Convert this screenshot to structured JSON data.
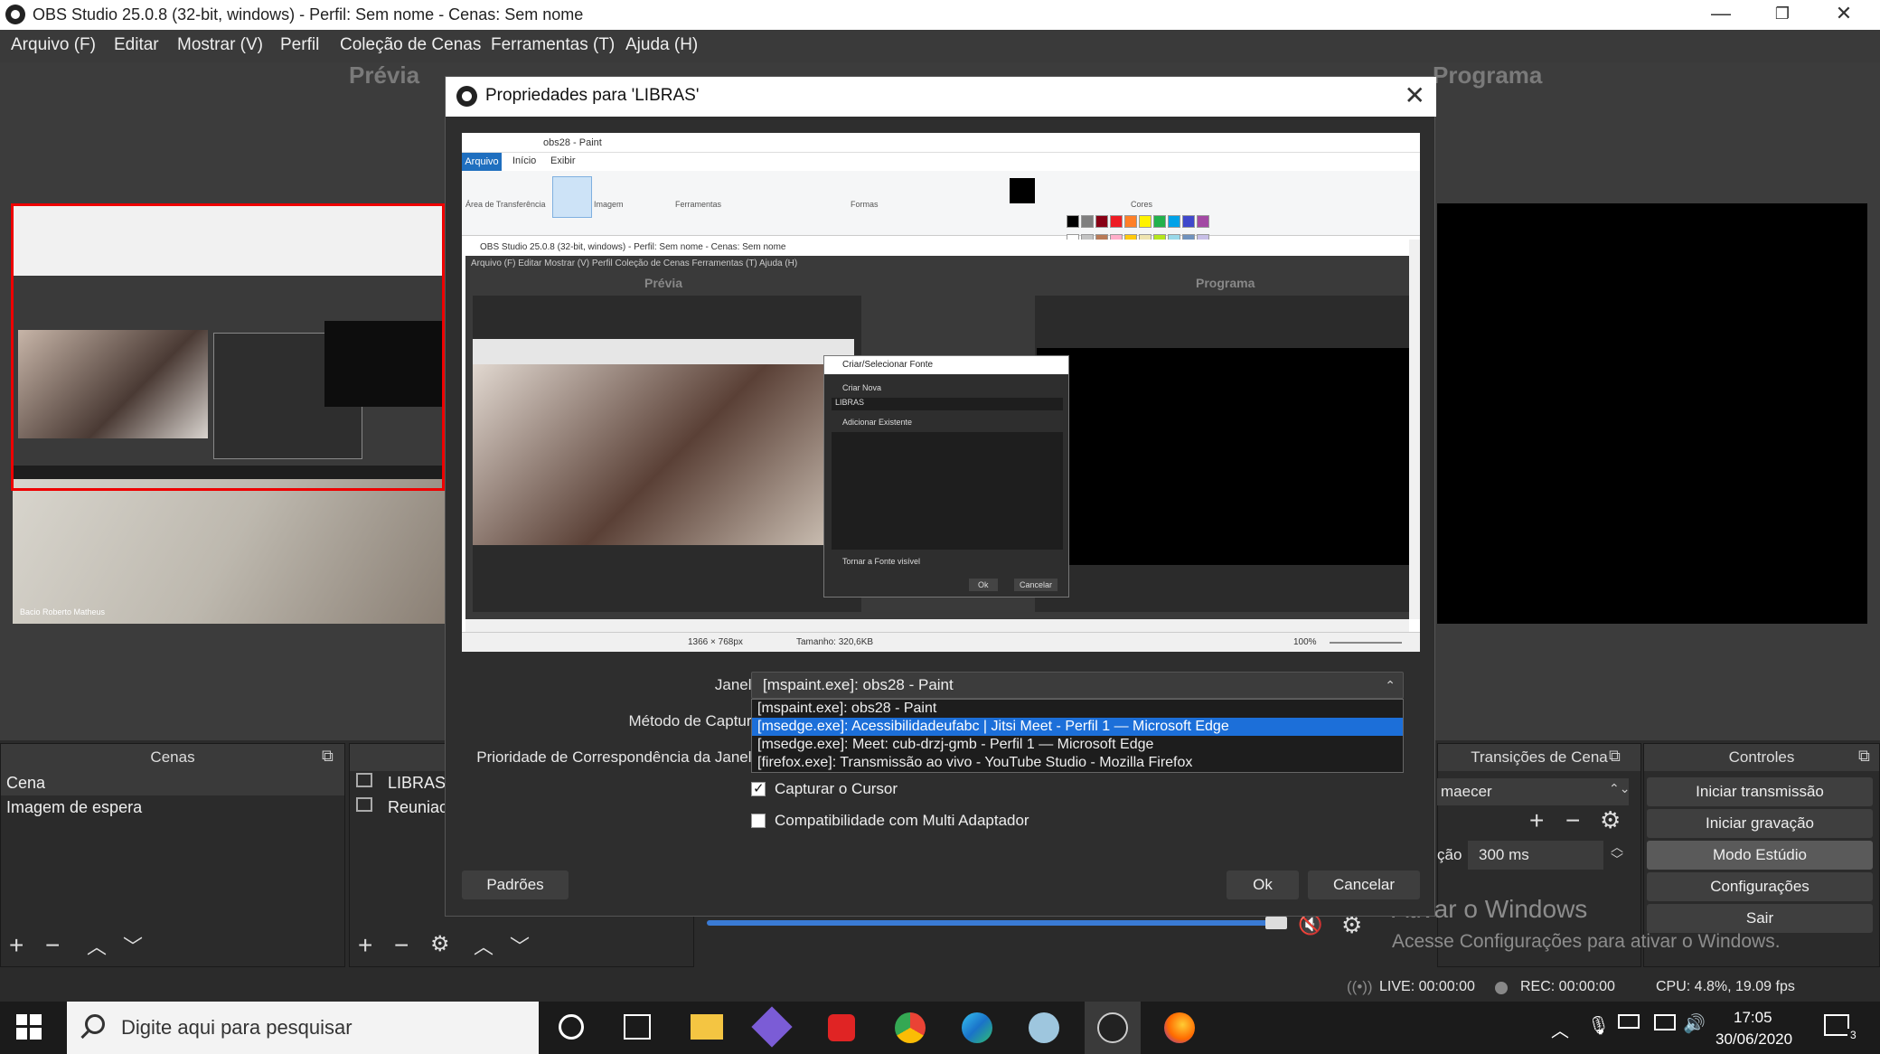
{
  "window": {
    "title": "OBS Studio 25.0.8 (32-bit, windows) - Perfil: Sem nome - Cenas: Sem nome",
    "minimize": "—",
    "restore": "❐",
    "close": "✕"
  },
  "menu": [
    "Arquivo (F)",
    "Editar",
    "Mostrar (V)",
    "Perfil",
    "Coleção de Cenas",
    "Ferramentas (T)",
    "Ajuda (H)"
  ],
  "main": {
    "preview_label": "Prévia",
    "program_label": "Programa"
  },
  "preview_thumb": {
    "caption": "Bacio Roberto Matheus"
  },
  "scenes": {
    "title": "Cenas",
    "items": [
      "Cena",
      "Imagem de espera"
    ]
  },
  "sources": {
    "items": [
      "LIBRAS",
      "Reuniao"
    ]
  },
  "transitions": {
    "title": "Transições de Cena",
    "selected": "maecer",
    "duration_label": "ção",
    "duration": "300 ms"
  },
  "controls": {
    "title": "Controles",
    "buttons": [
      "Iniciar transmissão",
      "Iniciar gravação",
      "Modo Estúdio",
      "Configurações",
      "Sair"
    ]
  },
  "status": {
    "live": "LIVE: 00:00:00",
    "rec": "REC: 00:00:00",
    "cpu": "CPU: 4.8%, 19.09 fps"
  },
  "watermark": {
    "line1": "Ativar o Windows",
    "line2": "Acesse Configurações para ativar o Windows."
  },
  "dialog": {
    "title": "Propriedades para 'LIBRAS'",
    "close": "✕",
    "capture": {
      "paint_title": "obs28 - Paint",
      "paint_tabs": [
        "Arquivo",
        "Início",
        "Exibir"
      ],
      "ribbon_groups": [
        "Área de Transferência",
        "Imagem",
        "Ferramentas",
        "Formas",
        "Cores"
      ],
      "obs_title": "OBS Studio 25.0.8 (32-bit, windows) - Perfil: Sem nome - Cenas: Sem nome",
      "obs_menu": "Arquivo (F)   Editar   Mostrar (V)   Perfil   Coleção de Cenas   Ferramentas (T)   Ajuda (H)",
      "preview": "Prévia",
      "program": "Programa",
      "inner_dialog_title": "Criar/Selecionar Fonte",
      "inner_create_new": "Criar Nova",
      "inner_name": "LIBRAS",
      "inner_add_existing": "Adicionar Existente",
      "inner_visible": "Tornar a Fonte visível",
      "inner_ok": "Ok",
      "inner_cancel": "Cancelar",
      "status_size": "1366 × 768px",
      "status_filesize": "Tamanho: 320,6KB",
      "status_zoom": "100%"
    },
    "labels": {
      "janela": "Janela",
      "metodo": "Método de Captura",
      "prioridade": "Prioridade de Correspondência da Janela"
    },
    "janela_selected": "[mspaint.exe]: obs28 - Paint",
    "janela_options": [
      "[mspaint.exe]: obs28 - Paint",
      "[msedge.exe]: Acessibilidadeufabc | Jitsi Meet - Perfil 1 — Microsoft Edge",
      "[msedge.exe]: Meet: cub-drzj-gmb - Perfil 1 — Microsoft Edge",
      "[firefox.exe]: Transmissão ao vivo - YouTube Studio - Mozilla Firefox"
    ],
    "capture_cursor": "Capturar o Cursor",
    "multi_adapter": "Compatibilidade com Multi Adaptador",
    "defaults": "Padrões",
    "ok": "Ok",
    "cancel": "Cancelar"
  },
  "taskbar": {
    "search_placeholder": "Digite aqui para pesquisar",
    "time": "17:05",
    "date": "30/06/2020",
    "notifications": "3"
  }
}
